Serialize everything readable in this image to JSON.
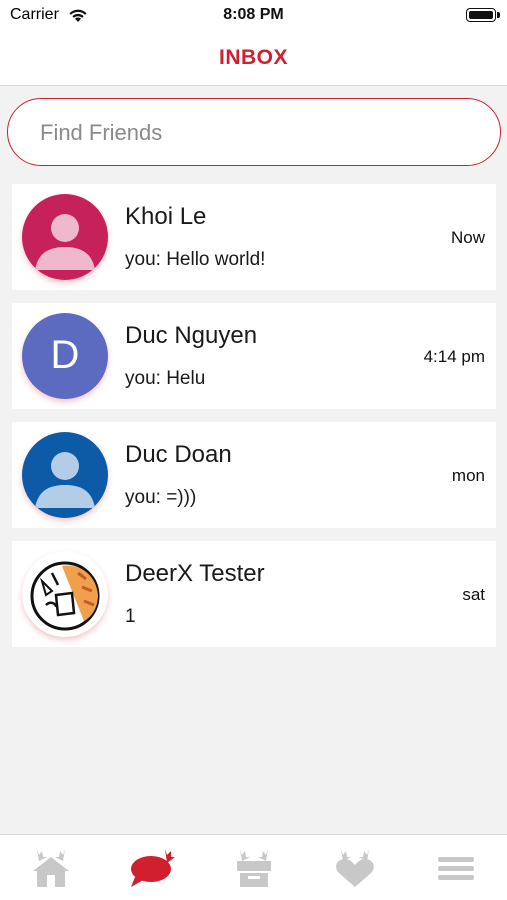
{
  "status_bar": {
    "carrier": "Carrier",
    "time": "8:08 PM"
  },
  "header": {
    "title": "INBOX"
  },
  "search": {
    "placeholder": "Find Friends",
    "value": ""
  },
  "conversations": [
    {
      "name": "Khoi Le",
      "last_message": "you: Hello world!",
      "time": "Now",
      "avatar": "person-icon",
      "avatar_color": "#c6215a"
    },
    {
      "name": "Duc Nguyen",
      "last_message": "you: Helu",
      "time": "4:14 pm",
      "avatar_letter": "D",
      "avatar_color": "#5c6bc0"
    },
    {
      "name": "Duc Doan",
      "last_message": "you: =)))",
      "time": "mon",
      "avatar": "person-icon",
      "avatar_color": "#0d5aa7"
    },
    {
      "name": "DeerX Tester",
      "last_message": "1",
      "time": "sat",
      "avatar": "deer-mascot-image"
    }
  ],
  "tabs": [
    {
      "name": "home",
      "icon": "home-antler-icon",
      "active": false
    },
    {
      "name": "inbox",
      "icon": "chat-antler-icon",
      "active": true
    },
    {
      "name": "box",
      "icon": "box-antler-icon",
      "active": false
    },
    {
      "name": "favorites",
      "icon": "heart-antler-icon",
      "active": false
    },
    {
      "name": "menu",
      "icon": "hamburger-menu-icon",
      "active": false
    }
  ],
  "colors": {
    "accent": "#d0202e",
    "inactive_icon": "#c8c8c8",
    "background": "#f2f2f2"
  }
}
